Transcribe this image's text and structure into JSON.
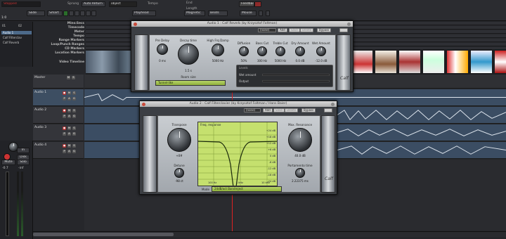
{
  "toolbar": {
    "status": "Stopped",
    "sync": "Sprung",
    "auto_return": "Auto Return",
    "object": "object",
    "tempo": "Tempo",
    "length": "Length",
    "end": "End",
    "feedback": "Feedback",
    "slide": "Slide",
    "smart": "Smart",
    "playhead": "Playhead",
    "magnetic": "Magnetic",
    "beats": "Beats",
    "mouse": "Mouse",
    "grid_value": "1:0"
  },
  "editor_list": {
    "tabs": [
      "01",
      "02"
    ],
    "items": [
      "Audio 1",
      "Calf Filterclav",
      "Calf Reverb"
    ]
  },
  "rulers": [
    "Mins:Secs",
    "Timecode",
    "Meter",
    "Tempo",
    "Range Markers",
    "Loop/Punch Ranges",
    "CD Markers",
    "Location Markers",
    "Video Timeline"
  ],
  "tracks": [
    {
      "name": "Master"
    },
    {
      "name": "Audio 1"
    },
    {
      "name": "Audio 2"
    },
    {
      "name": "Audio 3"
    },
    {
      "name": "Audio 4"
    }
  ],
  "track_buttons": {
    "rec": "●",
    "mute": "M",
    "solo": "S",
    "play": "P",
    "auto": "A",
    "g": "G"
  },
  "strip": {
    "in": "In",
    "disk": "Disk",
    "mute": "Mute",
    "solo": "Solo",
    "level": "-0.7",
    "ref": "-inf"
  },
  "reverb": {
    "title": "Audio 1 : Calf Reverb (by Krzysztof Foltman)",
    "preset": "(none)",
    "add": "Add",
    "save": "Save",
    "delete": "Delete",
    "bypass": "Bypass",
    "knobs": [
      {
        "label": "Pre Delay",
        "value": "0 ms"
      },
      {
        "label": "Decay time",
        "value": "1.5 s"
      },
      {
        "label": "High Frq Damp",
        "value": "5000 Hz"
      },
      {
        "label": "Diffusion",
        "value": "50%"
      },
      {
        "label": "Bass Cut",
        "value": "300 Hz"
      },
      {
        "label": "Treble Cut",
        "value": "5000 Hz"
      },
      {
        "label": "Dry Amount",
        "value": "0.0 dB"
      },
      {
        "label": "Wet Amount",
        "value": "-12.0 dB"
      }
    ],
    "room_size_label": "Room size",
    "room_size": "Tunnel-like",
    "levels_title": "Levels",
    "wet_label": "Wet amount",
    "output_label": "Output"
  },
  "filter": {
    "title": "Audio 2 : Calf Filterclavier (by Krzysztof Foltman / Hans Baier)",
    "preset": "(none)",
    "add": "Add",
    "save": "Save",
    "delete": "Delete",
    "bypass": "Bypass",
    "transpose_label": "Transpose",
    "transpose": "+0#",
    "detune_label": "Detune",
    "detune": "-98 ct",
    "freq_title": "Freq. response",
    "resonance_label": "Max. Resonance",
    "resonance": "40.0 dB",
    "portamento_label": "Portamento time",
    "portamento": "2.22375 ms",
    "mode_label": "Mode",
    "mode": "24dB/oct Bandreject",
    "db_labels": [
      "+24 dB",
      "+18 dB",
      "+12 dB",
      "+6 dB",
      "0 dB",
      "-6 dB",
      "-12 dB",
      "-18 dB",
      "-24 dB",
      "-30 dB"
    ],
    "hz_labels": [
      "100 Hz",
      "1 kHz",
      "10 kHz"
    ]
  },
  "colors": {
    "accent_red": "#c94a3a",
    "lcd_green": "#a9c852",
    "waveform": "#dfe6ee",
    "lane": "#3b4d63"
  }
}
